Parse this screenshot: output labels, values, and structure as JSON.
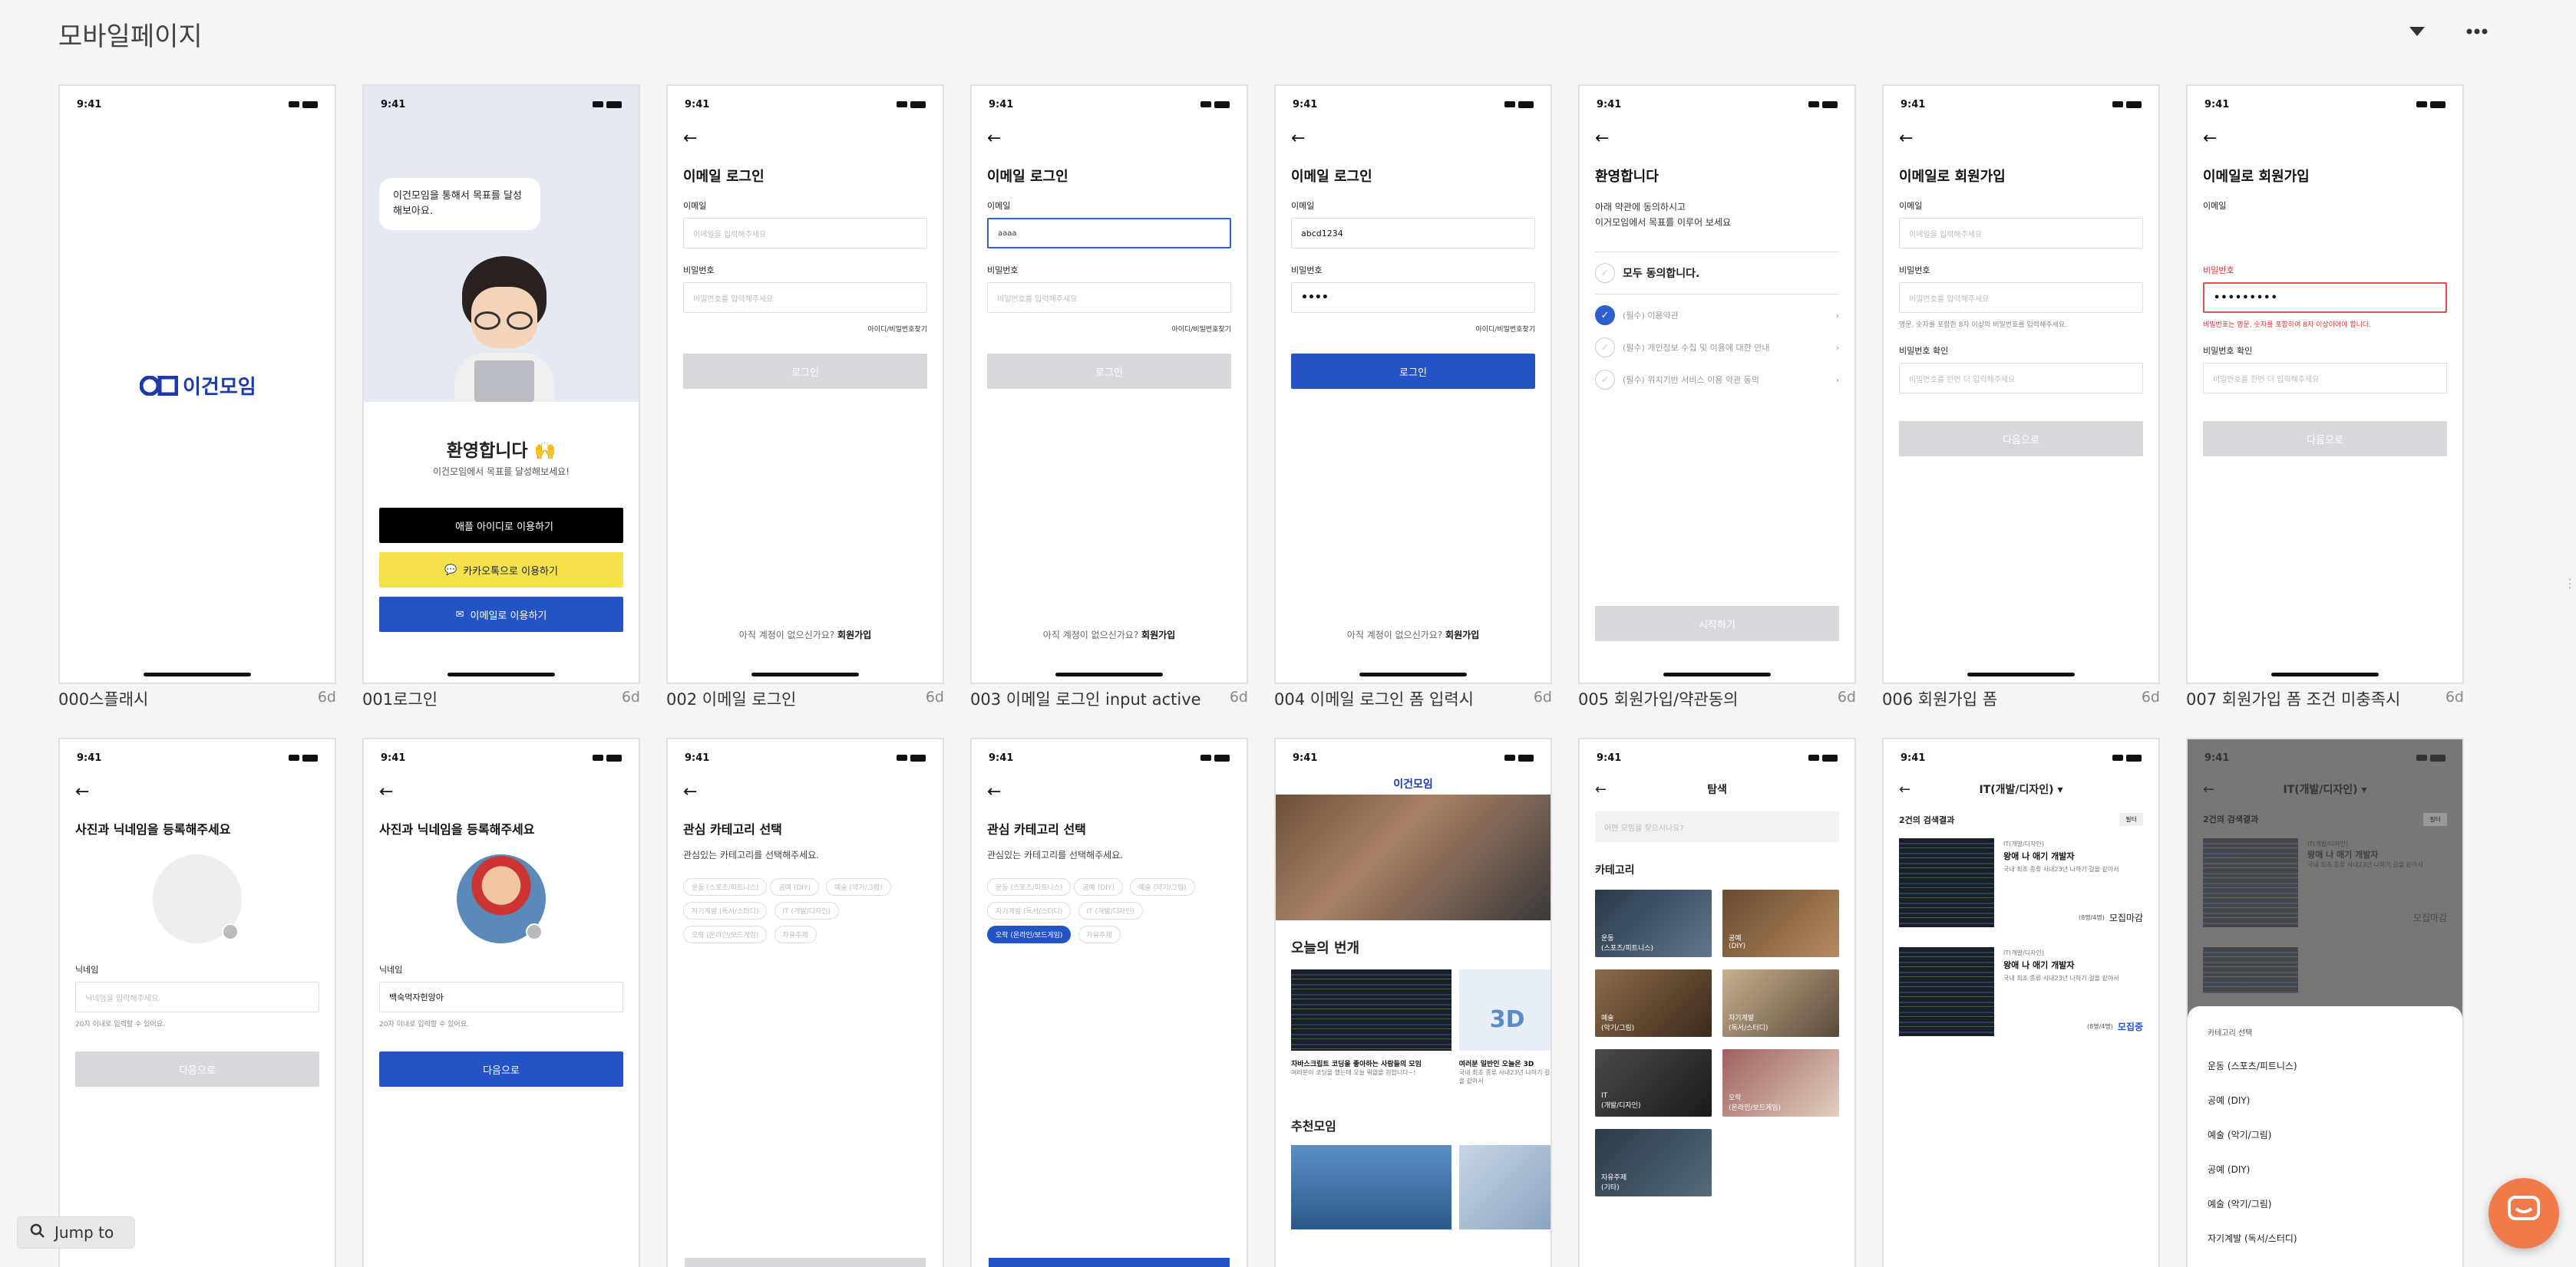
{
  "page": {
    "title": "모바일페이지"
  },
  "status_time": "9:41",
  "common": {
    "email_login_title": "이메일 로그인",
    "email_label": "이메일",
    "email_placeholder": "이메일을 입력해주세요",
    "pw_label": "비밀번호",
    "pw_placeholder": "비밀번호를 입력해주세요",
    "find_link": "아이디/비밀번호찾기",
    "login_btn": "로그인",
    "no_account": "아직 계정이 없으신가요?",
    "signup_link": "회원가입",
    "signup_title": "이메일로 회원가입",
    "pw_hint": "영문, 숫자를 포함한 8자 이상의 비밀번호를 입력해주세요.",
    "pw_error": "비밀번호는 영문, 숫자를 포함하여 8자 이상이어야 합니다.",
    "pw_confirm_label": "비밀번호 확인",
    "pw_confirm_placeholder": "비밀번호를 한번 더 입력해주세요",
    "next_btn": "다음으로",
    "profile_title": "사진과 닉네임을 등록해주세요",
    "nickname_label": "닉네임",
    "nickname_placeholder": "닉네임을 입력해주세요.",
    "nickname_hint": "20자 이내로 입력할 수 있어요.",
    "nickname_value": "백숙먹자헌앙아",
    "category_title": "관심 카테고리 선택",
    "category_sub": "관심있는 카테고리를 선택해주세요."
  },
  "frames": [
    {
      "caption": "000스플래시",
      "age": "6d",
      "logo": "이건모임"
    },
    {
      "caption": "001로그인",
      "age": "6d",
      "bubble": "이건모임을 통해서 목표를 달성해보아요.",
      "welcome": "환영합니다 🙌",
      "welcome_sub": "이건모임에서 목표를 달성해보세요!",
      "apple_btn": "애플 아이디로 이용하기",
      "kakao_btn": "카카오톡으로 이용하기",
      "email_btn": "이메일로 이용하기"
    },
    {
      "caption": "002 이메일 로그인",
      "age": "6d"
    },
    {
      "caption": "003 이메일 로그인 input active",
      "age": "6d",
      "email_value": "aaaa"
    },
    {
      "caption": "004 이메일 로그인 폼 입력시",
      "age": "6d",
      "email_value": "abcd1234",
      "pw_value": "••••"
    },
    {
      "caption": "005 회원가입/약관동의",
      "age": "6d",
      "title": "환영합니다",
      "sub1": "아래 약관에 동의하시고",
      "sub2": "이거모임에서 목표를 이루어 보세요",
      "all_agree": "모두 동의합니다.",
      "terms": [
        "(필수) 이용약관",
        "(필수) 개인정보 수집 및 이용에 대한 안내",
        "(필수) 위치기반 서비스 이용 약관 동의"
      ],
      "start_btn": "시작하기"
    },
    {
      "caption": "006 회원가입 폼",
      "age": "6d"
    },
    {
      "caption": "007 회원가입 폼 조건 미충족시",
      "age": "6d",
      "pw_value": "•••••••••"
    }
  ],
  "chips": [
    "운동 (스포츠/피트니스)",
    "공예 (DIY)",
    "예술 (악기/그림)",
    "자기계발 (독서/스터디)",
    "IT (개발/디자인)",
    "오락 (온라인/보드게임)",
    "자유주제"
  ],
  "feed": {
    "logo": "이건모임",
    "today_title": "오늘의 번개",
    "card1_title": "자바스크립트 코딩을 좋아하는 사람들의 모임",
    "card1_sub": "여러분이 코딩을 했는데 오늘 뭐없을 원합니다~!",
    "card2_title": "여러분 일반인 오늘은 3D",
    "card2_sub": "국내 최초 종류 사내23년 나하기 걸을 같아서",
    "recommend": "추천모임"
  },
  "explore": {
    "title": "탐색",
    "search_placeholder": "어떤 모임을 찾으시나요?",
    "category": "카테고리",
    "tiles": [
      {
        "l1": "운동",
        "l2": "(스포츠/피트니스)"
      },
      {
        "l1": "공예",
        "l2": "(DIY)"
      },
      {
        "l1": "예술",
        "l2": "(악기/그림)"
      },
      {
        "l1": "자기계발",
        "l2": "(독서/스터디)"
      },
      {
        "l1": "IT",
        "l2": "(개발/디자인)"
      },
      {
        "l1": "오락",
        "l2": "(온라인/보드게임)"
      },
      {
        "l1": "자유주제",
        "l2": "(기타)"
      }
    ]
  },
  "list": {
    "title": "IT(개발/디자인)",
    "count": "2건의 검색결과",
    "filter": "필터",
    "item_tag": "IT(개발/디자인)",
    "item_title": "왕애 나 애기 개발자",
    "item_desc": "국내 최초 종류 사내23년 나하기 걸을 같아서",
    "members": "(8명/4명)",
    "status_closed": "모집마감",
    "status_open": "모집중"
  },
  "sheet": {
    "title": "카테고리 선택",
    "items": [
      "운동 (스포츠/피트니스)",
      "공예 (DIY)",
      "예술 (악기/그림)",
      "공예 (DIY)",
      "예술 (악기/그림)",
      "자기계발 (독서/스터디)"
    ]
  },
  "jump_to": "Jump to"
}
